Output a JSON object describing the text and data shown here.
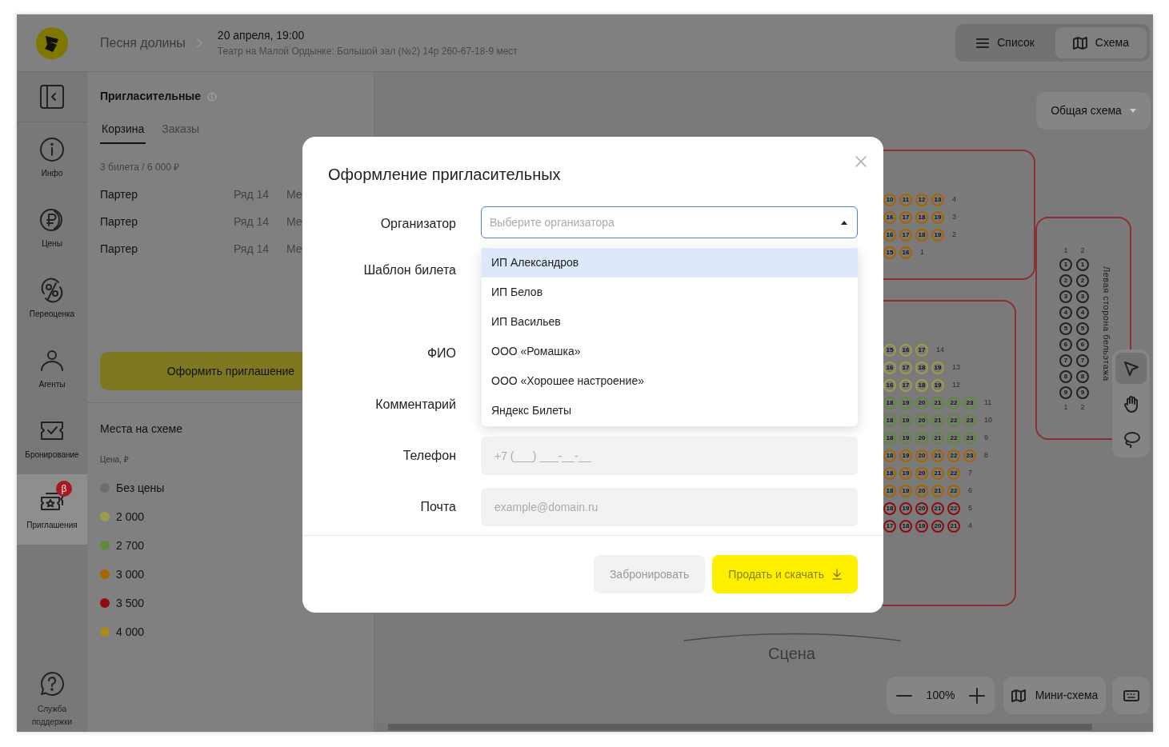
{
  "header": {
    "breadcrumb": "Песня долины",
    "event_title": "20 апреля, 19:00",
    "event_subtitle": "Театр на Малой Ордынке: Большой зал (№2) 14р 260-67-18-9 мест",
    "views": [
      {
        "kind": "list",
        "label": "Список",
        "selected": false
      },
      {
        "kind": "map",
        "label": "Схема",
        "selected": true
      }
    ]
  },
  "nav": {
    "items": [
      {
        "kind": "info",
        "label": "Инфо",
        "selected": false
      },
      {
        "kind": "prices",
        "label": "Цены",
        "selected": false
      },
      {
        "kind": "discount",
        "label": "Переоценка",
        "selected": false
      },
      {
        "kind": "agents",
        "label": "Агенты",
        "selected": false
      },
      {
        "kind": "booking",
        "label": "Бронирование",
        "selected": false
      },
      {
        "kind": "invites",
        "label": "Приглашения",
        "selected": true,
        "badge": "β"
      }
    ],
    "support": "Служба поддержки"
  },
  "panel": {
    "title": "Пригласительные",
    "tabs": [
      {
        "label": "Корзина",
        "selected": true
      },
      {
        "label": "Заказы",
        "selected": false
      }
    ],
    "summary": "3 билета / 6 000 ₽",
    "tickets": [
      {
        "zone": "Партер",
        "row": "Ряд 14",
        "seat": "Ме"
      },
      {
        "zone": "Партер",
        "row": "Ряд 14",
        "seat": "Ме"
      },
      {
        "zone": "Партер",
        "row": "Ряд 14",
        "seat": "Ме"
      }
    ],
    "action": "Оформить приглашение",
    "legend": {
      "title": "Места на схеме",
      "subtitle": "Цена, ₽",
      "items": [
        {
          "label": "Без цены",
          "color": "#6e6e6e"
        },
        {
          "label": "2 000",
          "color": "#a09b4b"
        },
        {
          "label": "2 700",
          "color": "#5e8a3a"
        },
        {
          "label": "3 000",
          "color": "#a86400"
        },
        {
          "label": "3 500",
          "color": "#8c0c12"
        },
        {
          "label": "4 000",
          "color": "#a88a20"
        }
      ]
    }
  },
  "map": {
    "view_select": "Общая схема",
    "sections": [
      {
        "kind": "rows",
        "rows": [
          {
            "label": "4",
            "color": "#a86400",
            "seats": [
              "10",
              "11",
              "12",
              "13"
            ]
          },
          {
            "label": "3",
            "color": "#a86400",
            "seats": [
              "16",
              "17",
              "18",
              "19"
            ]
          },
          {
            "label": "2",
            "color": "#a86400",
            "seats": [
              "16",
              "17",
              "18",
              "19"
            ]
          },
          {
            "label": "1",
            "color": "#a86400",
            "seats": [
              "15",
              "16"
            ]
          }
        ]
      },
      {
        "kind": "rows",
        "rows": [
          {
            "label": "14",
            "color": "#a09b4b",
            "seats": [
              "15",
              "16",
              "17"
            ]
          },
          {
            "label": "13",
            "color": "#a09b4b",
            "seats": [
              "16",
              "17",
              "18",
              "19"
            ]
          },
          {
            "label": "12",
            "color": "#a09b4b",
            "seats": [
              "16",
              "17",
              "18",
              "19"
            ]
          },
          {
            "label": "11",
            "color": "#5e8a3a",
            "seats": [
              "18",
              "19",
              "20",
              "21",
              "22",
              "23"
            ]
          },
          {
            "label": "10",
            "color": "#5e8a3a",
            "seats": [
              "18",
              "19",
              "20",
              "21",
              "22",
              "23"
            ]
          },
          {
            "label": "9",
            "color": "#5e8a3a",
            "seats": [
              "18",
              "19",
              "20",
              "21",
              "22",
              "23"
            ]
          },
          {
            "label": "8",
            "color": "#a86400",
            "seats": [
              "18",
              "19",
              "20",
              "21",
              "22",
              "23"
            ]
          },
          {
            "label": "7",
            "color": "#a86400",
            "seats": [
              "18",
              "19",
              "20",
              "21",
              "22"
            ]
          },
          {
            "label": "6",
            "color": "#a86400",
            "seats": [
              "18",
              "19",
              "20",
              "21",
              "22"
            ]
          },
          {
            "label": "5",
            "color": "#8c0c12",
            "seats": [
              "18",
              "19",
              "20",
              "21",
              "22"
            ]
          },
          {
            "label": "4",
            "color": "#8c0c12",
            "seats": [
              "17",
              "18",
              "19",
              "20",
              "21"
            ]
          }
        ]
      },
      {
        "kind": "columns",
        "title": "Левая сторона бельэтажа",
        "top_labels": [
          "1",
          "2"
        ],
        "bottom_labels": [
          "1",
          "2"
        ],
        "columns": [
          {
            "seats": [
              "1",
              "2",
              "3",
              "4",
              "5",
              "6",
              "7",
              "8",
              "9"
            ]
          },
          {
            "seats": [
              "1",
              "2",
              "3",
              "4",
              "5",
              "6",
              "7",
              "8",
              "9"
            ]
          }
        ]
      }
    ],
    "stage": "Сцена",
    "tools": [
      {
        "kind": "pointer",
        "selected": true
      },
      {
        "kind": "hand",
        "selected": false
      },
      {
        "kind": "lasso",
        "selected": false
      }
    ],
    "zoom": "100%",
    "minimap": "Мини-схема"
  },
  "modal": {
    "title": "Оформление пригласительных",
    "fields": [
      {
        "kind": "select",
        "label": "Организатор",
        "placeholder": "Выберите организатора",
        "expanded": true,
        "options": [
          {
            "label": "ИП Александров",
            "selected": true
          },
          {
            "label": "ИП Белов",
            "selected": false
          },
          {
            "label": "ИП Васильев",
            "selected": false
          },
          {
            "label": "ООО «Ромашка»",
            "selected": false
          },
          {
            "label": "ООО «Хорошее настроение»",
            "selected": false
          },
          {
            "label": "Яндекс Билеты",
            "selected": false
          }
        ]
      },
      {
        "kind": "covered",
        "label": "Шаблон билета"
      },
      {
        "kind": "covered",
        "label": "ФИО"
      },
      {
        "kind": "covered",
        "label": "Комментарий"
      },
      {
        "kind": "input",
        "label": "Телефон",
        "placeholder": "+7 (___) ___-__-__"
      },
      {
        "kind": "input",
        "label": "Почта",
        "placeholder": "example@domain.ru"
      }
    ],
    "buttons": [
      {
        "kind": "secondary",
        "label": "Забронировать",
        "disabled": true
      },
      {
        "kind": "primary",
        "label": "Продать и скачать",
        "disabled": true
      }
    ]
  }
}
